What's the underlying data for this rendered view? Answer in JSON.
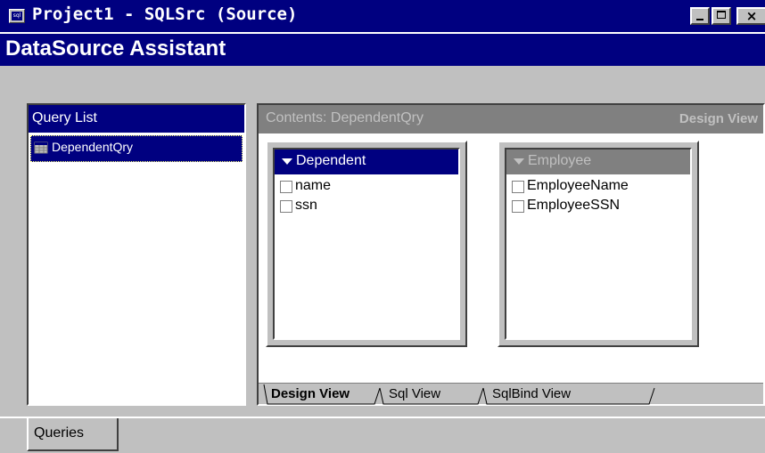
{
  "window": {
    "title": "Project1 - SQLSrc (Source)",
    "app_icon": "sql-app-icon",
    "close_glyph": "×"
  },
  "header": {
    "title": "DataSource Assistant"
  },
  "query_list": {
    "heading": "Query List",
    "items": [
      {
        "label": "DependentQry",
        "icon": "query-grid-icon"
      }
    ]
  },
  "contents": {
    "heading": "Contents: DependentQry",
    "mode_label": "Design View",
    "tables": [
      {
        "name": "Dependent",
        "active": true,
        "fields": [
          "name",
          "ssn"
        ]
      },
      {
        "name": "Employee",
        "active": false,
        "fields": [
          "EmployeeName",
          "EmployeeSSN"
        ]
      }
    ],
    "tabs": [
      {
        "label": "Design View",
        "active": true
      },
      {
        "label": "Sql View",
        "active": false
      },
      {
        "label": "SqlBind View",
        "active": false
      }
    ]
  },
  "bottom_tabs": [
    {
      "label": "Queries",
      "active": true
    }
  ],
  "colors": {
    "title_bar": "#000080",
    "face": "#c0c0c0",
    "inactive_header": "#808080"
  }
}
